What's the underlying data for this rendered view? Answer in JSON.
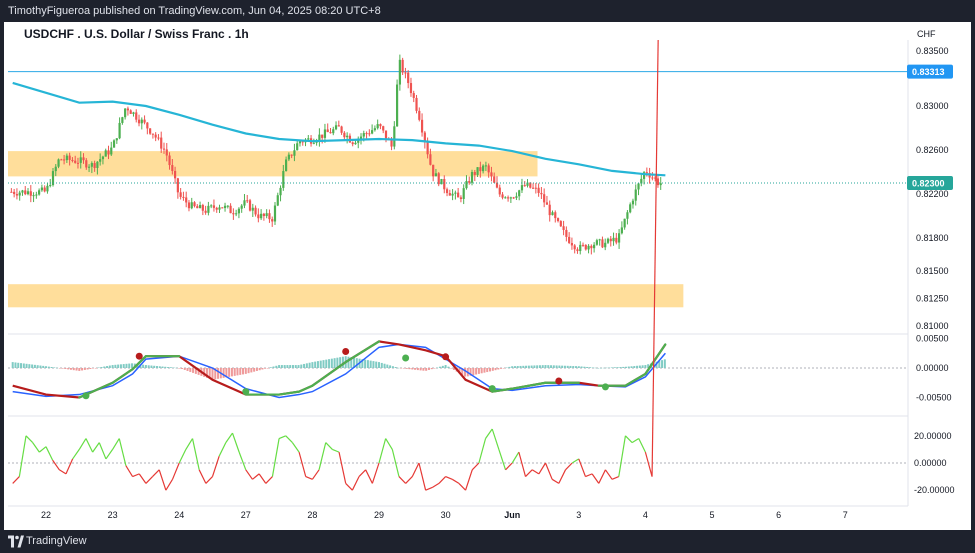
{
  "header": {
    "text": "TimothyFigueroa published on TradingView.com, Jun 04, 2025 08:20 UTC+8"
  },
  "footer": {
    "brand": "TradingView"
  },
  "chart": {
    "title": "USDCHF . U.S. Dollar / Swiss Franc . 1h",
    "currency": "CHF",
    "colors": {
      "up": "#4caf50",
      "down": "#ef5350",
      "ma": "#26b5d6",
      "zone": "#ffd88a",
      "hline": "#2ba8e6",
      "price_label": "#26a69a",
      "level_label": "#2196f3",
      "macd_fast": "#4caf50",
      "macd_slow": "#2962ff",
      "macd_bear": "#b71c1c",
      "hist_up": "#80cbc4",
      "hist_down": "#ef9a9a",
      "osc_up": "#66dd44",
      "osc_down": "#e53935"
    }
  },
  "chart_data": [
    {
      "type": "candlestick",
      "title": "USDCHF . U.S. Dollar / Swiss Franc . 1h",
      "x_labels": [
        "22",
        "23",
        "24",
        "27",
        "28",
        "29",
        "30",
        "Jun",
        "3",
        "4",
        "5",
        "6",
        "7"
      ],
      "y_ticks": [
        "0.83500",
        "0.83000",
        "0.82600",
        "0.82200",
        "0.81800",
        "0.81500",
        "0.81250",
        "0.81000"
      ],
      "ylim": [
        0.8096,
        0.8355
      ],
      "price_labels": {
        "last": "0.82300",
        "level": "0.83313"
      },
      "horizontal_line": 0.83313,
      "zones": [
        [
          0.8236,
          0.8259
        ],
        [
          0.8117,
          0.8138
        ]
      ],
      "path_x_day": [
        0,
        0.2,
        0.5,
        0.7,
        1.0,
        1.2,
        1.4,
        1.6,
        1.8,
        2.0,
        2.2,
        2.4,
        2.6,
        2.8,
        3.0,
        3.2,
        3.4,
        3.6,
        3.8,
        4.0,
        4.2,
        4.4,
        4.6,
        4.8,
        5.0,
        5.2,
        5.3,
        5.45,
        5.6,
        5.8,
        6.0,
        6.2,
        6.4,
        6.6,
        6.8,
        7.0,
        7.2,
        7.4,
        7.6,
        7.8,
        8.0,
        8.2,
        8.4,
        8.6,
        8.8,
        9.0,
        9.2
      ],
      "path_price": [
        0.8222,
        0.8252,
        0.825,
        0.8246,
        0.8262,
        0.83,
        0.8288,
        0.8276,
        0.8258,
        0.8218,
        0.8208,
        0.8205,
        0.821,
        0.8204,
        0.8212,
        0.82,
        0.8198,
        0.8248,
        0.8268,
        0.827,
        0.8275,
        0.828,
        0.8268,
        0.8275,
        0.8282,
        0.8262,
        0.834,
        0.832,
        0.8292,
        0.824,
        0.8225,
        0.8215,
        0.8238,
        0.8245,
        0.822,
        0.8218,
        0.8228,
        0.8222,
        0.82,
        0.8182,
        0.817,
        0.8175,
        0.8175,
        0.818,
        0.8215,
        0.8242,
        0.823
      ],
      "ma_x_day": [
        -0.5,
        0.5,
        1.0,
        1.5,
        2.0,
        2.5,
        3.0,
        3.5,
        4.0,
        4.5,
        5.0,
        5.5,
        6.0,
        6.5,
        7.0,
        7.5,
        8.0,
        8.5,
        9.0,
        9.3
      ],
      "ma_price": [
        0.8321,
        0.8303,
        0.8304,
        0.83,
        0.8292,
        0.8283,
        0.8275,
        0.827,
        0.8268,
        0.8269,
        0.827,
        0.8269,
        0.8266,
        0.8264,
        0.8259,
        0.8252,
        0.8247,
        0.8241,
        0.8238,
        0.8237
      ]
    },
    {
      "type": "line",
      "indicator": "MACD",
      "y_ticks": [
        "0.00500",
        "0.00000",
        "-0.00500"
      ],
      "ylim": [
        -0.0075,
        0.0065
      ],
      "x_day": [
        -0.5,
        0.0,
        0.5,
        1.0,
        1.3,
        1.5,
        2.0,
        2.5,
        3.0,
        3.5,
        3.8,
        4.0,
        4.5,
        5.0,
        5.3,
        5.7,
        6.0,
        6.3,
        6.7,
        7.0,
        7.5,
        8.0,
        8.3,
        8.7,
        9.0,
        9.3
      ],
      "fast": [
        -0.003,
        -0.0045,
        -0.005,
        -0.0025,
        -0.0002,
        0.002,
        0.002,
        -0.002,
        -0.0045,
        -0.0045,
        -0.004,
        -0.003,
        0.001,
        0.0045,
        0.004,
        0.003,
        0.002,
        -0.002,
        -0.004,
        -0.0035,
        -0.0025,
        -0.0025,
        -0.003,
        -0.003,
        -0.001,
        0.004
      ],
      "slow": [
        -0.004,
        -0.0048,
        -0.0045,
        -0.003,
        -0.001,
        0.0015,
        0.002,
        0.0,
        -0.0035,
        -0.005,
        -0.0045,
        -0.004,
        -0.001,
        0.0035,
        0.004,
        0.0035,
        0.0015,
        -0.0005,
        -0.0035,
        -0.0038,
        -0.003,
        -0.0028,
        -0.003,
        -0.0032,
        -0.0015,
        0.0025
      ],
      "hist": [
        0.001,
        0.0003,
        -0.0005,
        0.0005,
        0.0008,
        0.0005,
        0.0,
        -0.002,
        -0.001,
        0.0005,
        0.0005,
        0.001,
        0.002,
        0.001,
        0.0,
        -0.0005,
        0.0005,
        -0.0015,
        -0.0005,
        0.0003,
        0.0005,
        0.0003,
        0.0,
        0.0002,
        0.0005,
        0.0015
      ],
      "cross_points": [
        [
          0.6,
          -0.0047,
          "bull"
        ],
        [
          1.4,
          0.002,
          "bear"
        ],
        [
          3.0,
          -0.004,
          "bull"
        ],
        [
          4.5,
          0.0028,
          "bear"
        ],
        [
          5.4,
          0.0017,
          "bull"
        ],
        [
          6.0,
          0.0019,
          "bear"
        ],
        [
          6.7,
          -0.0035,
          "bull"
        ],
        [
          7.7,
          -0.0022,
          "bear"
        ],
        [
          8.4,
          -0.0032,
          "bull"
        ]
      ]
    },
    {
      "type": "line",
      "indicator": "Oscillator",
      "y_ticks": [
        "20.00000",
        "0.00000",
        "-20.00000"
      ],
      "ylim": [
        -26,
        26
      ],
      "x_day": [
        -0.5,
        -0.4,
        -0.3,
        -0.2,
        -0.1,
        0.0,
        0.1,
        0.2,
        0.3,
        0.4,
        0.5,
        0.6,
        0.7,
        0.8,
        0.9,
        1.0,
        1.1,
        1.2,
        1.3,
        1.4,
        1.5,
        1.6,
        1.7,
        1.8,
        1.9,
        2.0,
        2.1,
        2.2,
        2.3,
        2.4,
        2.5,
        2.6,
        2.7,
        2.8,
        2.9,
        3.0,
        3.1,
        3.2,
        3.3,
        3.4,
        3.5,
        3.6,
        3.7,
        3.8,
        3.9,
        4.0,
        4.1,
        4.2,
        4.3,
        4.4,
        4.5,
        4.6,
        4.7,
        4.8,
        4.9,
        5.0,
        5.1,
        5.2,
        5.3,
        5.4,
        5.5,
        5.6,
        5.7,
        5.8,
        5.9,
        6.0,
        6.1,
        6.2,
        6.3,
        6.4,
        6.5,
        6.6,
        6.7,
        6.8,
        6.9,
        7.0,
        7.1,
        7.2,
        7.3,
        7.4,
        7.5,
        7.6,
        7.7,
        7.8,
        7.9,
        8.0,
        8.1,
        8.2,
        8.3,
        8.4,
        8.5,
        8.6,
        8.7,
        8.8,
        8.9,
        9.0,
        9.1,
        9.2
      ],
      "values": [
        -15,
        -10,
        20,
        15,
        8,
        12,
        2,
        -5,
        -8,
        3,
        10,
        18,
        8,
        15,
        3,
        10,
        18,
        -2,
        -10,
        -8,
        -15,
        -10,
        -5,
        -20,
        -12,
        0,
        10,
        18,
        -5,
        -15,
        -10,
        5,
        15,
        22,
        8,
        -5,
        -12,
        -8,
        -15,
        -10,
        18,
        20,
        15,
        8,
        -10,
        -12,
        -5,
        15,
        10,
        8,
        -15,
        -20,
        -10,
        -5,
        -15,
        0,
        18,
        10,
        -10,
        -15,
        -10,
        0,
        -20,
        -18,
        -15,
        -10,
        -12,
        -15,
        -20,
        -5,
        0,
        18,
        25,
        10,
        -5,
        0,
        8,
        -10,
        -5,
        -8,
        0,
        -12,
        -15,
        -5,
        0,
        3,
        -10,
        -8,
        -15,
        -5,
        -12,
        -10,
        20,
        15,
        18,
        8,
        -10
      ]
    }
  ]
}
